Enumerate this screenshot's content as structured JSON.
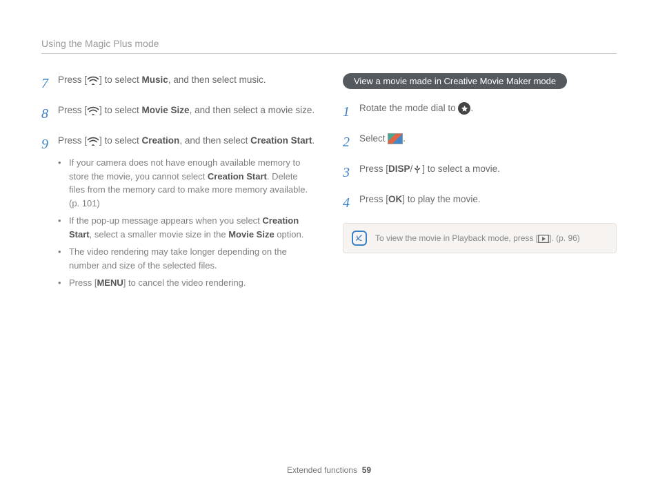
{
  "header": "Using the Magic Plus mode",
  "left": {
    "step7": {
      "num": "7",
      "pre": "Press [",
      "mid": "] to select ",
      "b1": "Music",
      "post": ", and then select music."
    },
    "step8": {
      "num": "8",
      "pre": "Press [",
      "mid": "] to select ",
      "b1": "Movie Size",
      "post": ", and then select a movie size."
    },
    "step9": {
      "num": "9",
      "pre": "Press [",
      "mid": "] to select ",
      "b1": "Creation",
      "post2": ", and then select ",
      "b2": "Creation Start",
      "post3": ".",
      "bul1a": "If your camera does not have enough available memory to store the movie, you cannot select ",
      "bul1b": "Creation Start",
      "bul1c": ". Delete files from the memory card to make more memory available. (p. 101)",
      "bul2a": "If the pop-up message appears when you select ",
      "bul2b": "Creation Start",
      "bul2c": ", select a smaller movie size in the ",
      "bul2d": "Movie Size",
      "bul2e": " option.",
      "bul3": "The video rendering may take longer depending on the number and size of the selected files.",
      "bul4a": "Press [",
      "bul4b": "MENU",
      "bul4c": "] to cancel the video rendering."
    }
  },
  "right": {
    "pill": "View a movie made in Creative Movie Maker mode",
    "s1": {
      "num": "1",
      "pre": "Rotate the mode dial to ",
      "post": "."
    },
    "s2": {
      "num": "2",
      "pre": "Select ",
      "post": "."
    },
    "s3": {
      "num": "3",
      "pre": "Press [",
      "disp": "DISP",
      "slash": "/",
      "post": "] to select a movie."
    },
    "s4": {
      "num": "4",
      "pre": "Press [",
      "ok": "OK",
      "post": "] to play the movie."
    },
    "note": {
      "pre": "To view the movie in Playback mode, press [",
      "post": "]. (p. 96)"
    }
  },
  "footer": {
    "section": "Extended functions",
    "page": "59"
  }
}
